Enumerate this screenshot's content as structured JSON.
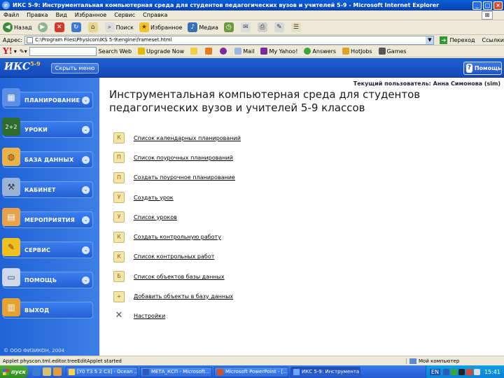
{
  "window": {
    "title": "ИКС 5-9: Инструментальная компьютерная среда для студентов педагогических вузов и учителей 5-9 - Microsoft Internet Explorer",
    "minimize": "_",
    "maximize": "□",
    "close": "×"
  },
  "menubar": {
    "items": [
      "Файл",
      "Правка",
      "Вид",
      "Избранное",
      "Сервис",
      "Справка"
    ]
  },
  "toolbar": {
    "back": "Назад",
    "search": "Поиск",
    "favorites": "Избранное",
    "media": "Медиа"
  },
  "address": {
    "label": "Адрес:",
    "url": "C:\\Program Files\\Physicon\\IKS 5-9\\engine\\frameset.html",
    "go": "Переход",
    "links": "Ссылки"
  },
  "yahoo": {
    "logo": "Y!",
    "search_web": "Search Web",
    "upgrade": "Upgrade Now",
    "mail": "Mail",
    "myyahoo": "My Yahoo!",
    "answers": "Answers",
    "hotjobs": "HotJobs",
    "games": "Games"
  },
  "app": {
    "logo": "ИКС",
    "logo_sup": "5-9",
    "hide_menu": "Скрыть меню",
    "help": "Помощь",
    "current_user_label": "Текущий пользователь:",
    "current_user": "Анна Симонова (sim)",
    "heading": "Инструментальная компьютерная среда для студентов педагогических вузов и учителей 5-9 классов",
    "copyright": "© ООО ФИЗИКОН, 2004"
  },
  "sidebar": {
    "items": [
      {
        "label": "ПЛАНИРОВАНИЕ",
        "icon": "calendar-icon"
      },
      {
        "label": "УРОКИ",
        "icon": "chalkboard-icon"
      },
      {
        "label": "БАЗА ДАННЫХ",
        "icon": "database-icon"
      },
      {
        "label": "КАБИНЕТ",
        "icon": "cabinet-icon"
      },
      {
        "label": "МЕРОПРИЯТИЯ",
        "icon": "events-icon"
      },
      {
        "label": "СЕРВИС",
        "icon": "wrench-icon"
      },
      {
        "label": "ПОМОЩЬ",
        "icon": "help-book-icon"
      },
      {
        "label": "ВЫХОД",
        "icon": "exit-icon"
      }
    ]
  },
  "links": [
    {
      "label": "Список календарных планирований",
      "glyph": "К"
    },
    {
      "label": "Список поурочных планирований",
      "glyph": "П"
    },
    {
      "label": "Создать поурочное планирование",
      "glyph": "П"
    },
    {
      "label": "Создать урок",
      "glyph": "У"
    },
    {
      "label": "Список уроков",
      "glyph": "У"
    },
    {
      "label": "Создать контрольную работу",
      "glyph": "К"
    },
    {
      "label": "Список контрольных работ",
      "glyph": "К"
    },
    {
      "label": "Список объектов базы данных",
      "glyph": "Б"
    },
    {
      "label": "Добавить объекты в базу данных",
      "glyph": "+"
    },
    {
      "label": "Настройки",
      "glyph": "✕"
    }
  ],
  "statusbar": {
    "message": "Applet physcon.tml.editor.treeEditApplet started",
    "zone": "Мой компьютер"
  },
  "taskbar": {
    "start": "пуск",
    "tasks": [
      "[Y0 T3 5 2 C3] - Ocean ...",
      "МЕТА_КСП - Microsoft...",
      "Microsoft PowerPoint - [...",
      "ИКС 5-9: Инструмента..."
    ],
    "lang": "EN",
    "clock": "15:41"
  }
}
